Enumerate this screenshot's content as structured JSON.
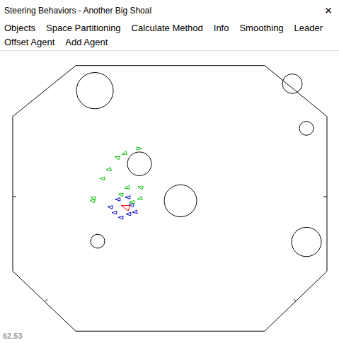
{
  "window": {
    "title": "Steering Behaviors - Another Big Shoal",
    "close": "×"
  },
  "menu_rows": [
    [
      "Objects",
      "Space Partitioning",
      "Calculate Method",
      "Info",
      "Smoothing",
      "Leader"
    ],
    [
      "Offset Agent",
      "Add Agent"
    ]
  ],
  "fps": "62.53",
  "agents": [
    {
      "role": "leader",
      "color": "#ff0000"
    },
    {
      "role": "neighbour",
      "color": "#0000cc"
    },
    {
      "role": "neighbour",
      "color": "#0000cc"
    },
    {
      "role": "neighbour",
      "color": "#0000cc"
    },
    {
      "role": "neighbour",
      "color": "#0000cc"
    },
    {
      "role": "neighbour",
      "color": "#0000cc"
    },
    {
      "role": "neighbour",
      "color": "#0000cc"
    },
    {
      "role": "neighbour",
      "color": "#0000cc"
    },
    {
      "role": "neighbour",
      "color": "#0000cc"
    },
    {
      "role": "other",
      "color": "#00c000"
    },
    {
      "role": "other",
      "color": "#00c000"
    },
    {
      "role": "other",
      "color": "#00c000"
    },
    {
      "role": "other",
      "color": "#00c000"
    },
    {
      "role": "other",
      "color": "#00c000"
    },
    {
      "role": "other",
      "color": "#00c000"
    },
    {
      "role": "other",
      "color": "#00c000"
    },
    {
      "role": "other",
      "color": "#00c000"
    },
    {
      "role": "other",
      "color": "#00c000"
    },
    {
      "role": "other",
      "color": "#00c000"
    },
    {
      "role": "other",
      "color": "#00c000"
    },
    {
      "role": "other",
      "color": "#00c000"
    }
  ]
}
